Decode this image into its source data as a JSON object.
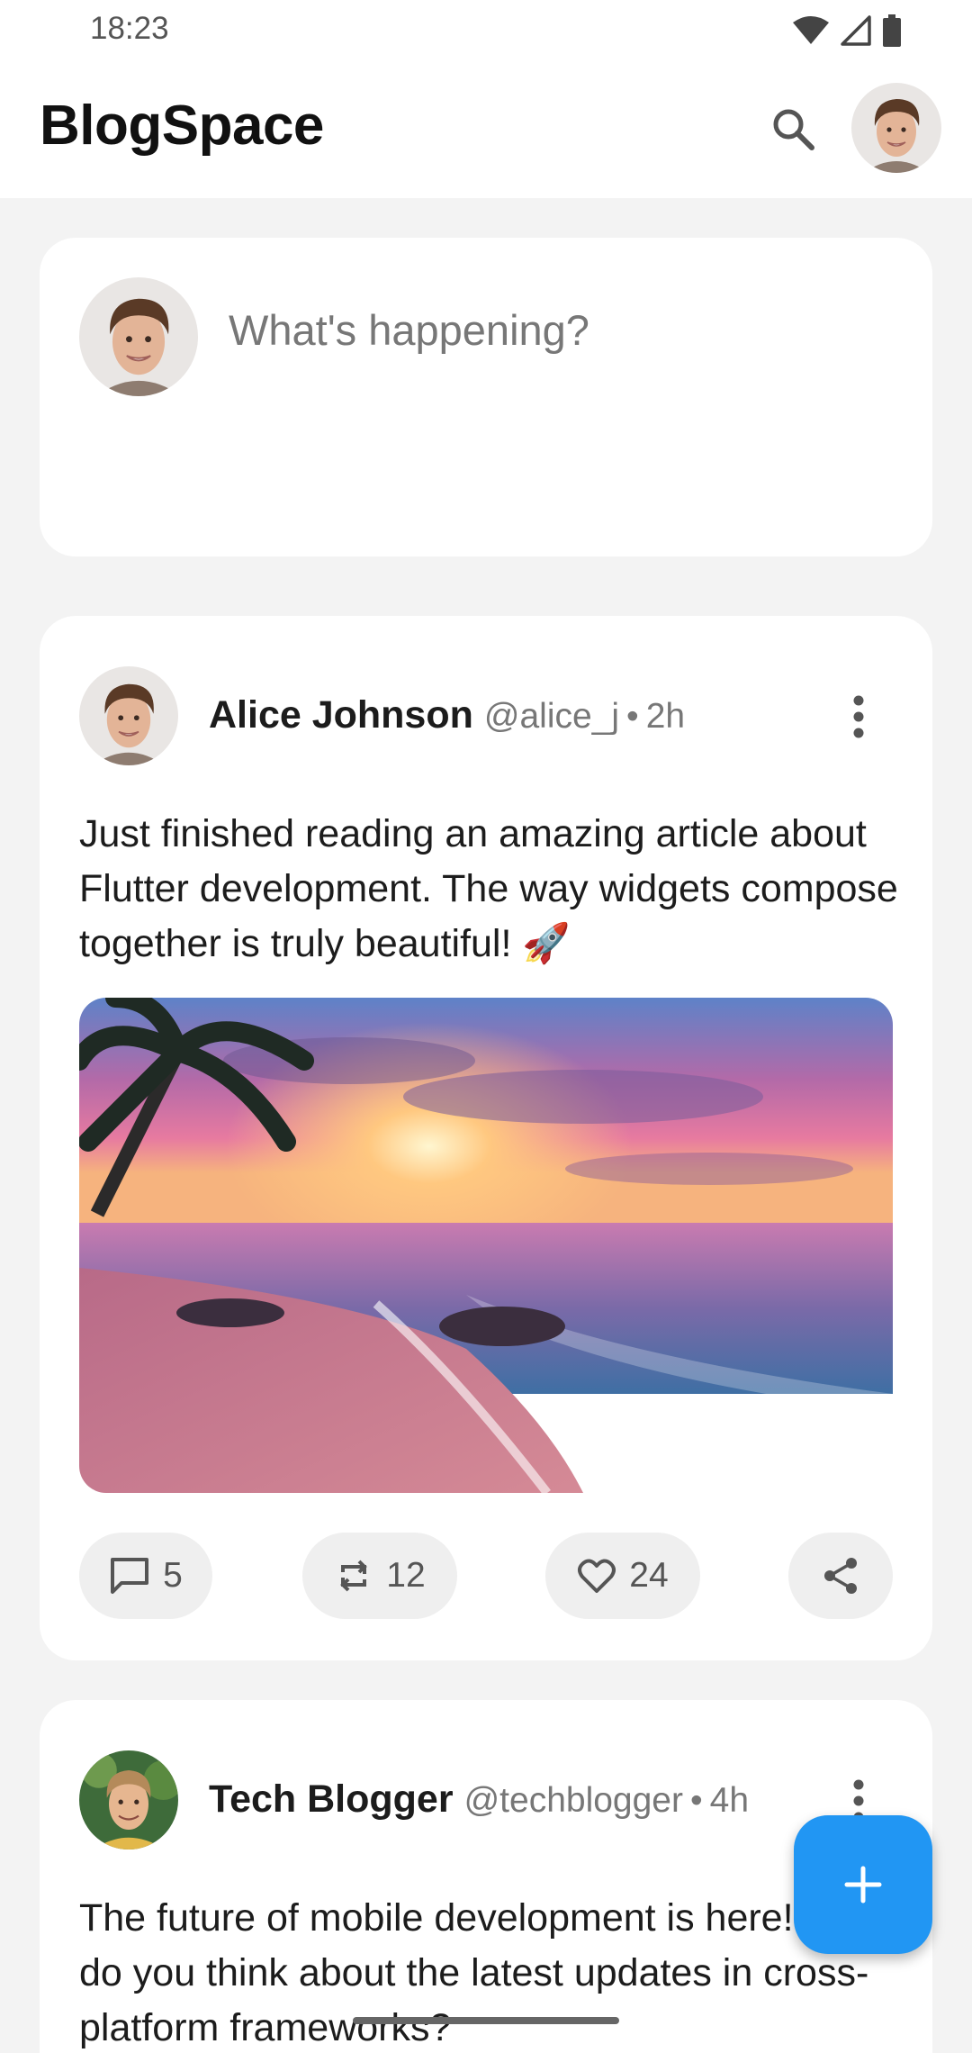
{
  "status_bar": {
    "time": "18:23",
    "icons": [
      "wifi-icon",
      "cell-signal-icon",
      "battery-icon"
    ]
  },
  "app_bar": {
    "title": "BlogSpace",
    "search_icon": "search-icon",
    "avatar": "profile-avatar"
  },
  "composer": {
    "placeholder": "What's happening?"
  },
  "posts": [
    {
      "author": "Alice Johnson",
      "handle": "@alice_j",
      "separator": "•",
      "time": "2h",
      "text": "Just finished reading an amazing article about Flutter development. The way widgets compose together is truly beautiful! 🚀",
      "image": "sunset-beach-image",
      "actions": {
        "comments": "5",
        "reposts": "12",
        "likes": "24"
      }
    },
    {
      "author": "Tech Blogger",
      "handle": "@techblogger",
      "separator": "•",
      "time": "4h",
      "text": "The future of mobile development is here! What do you think about the latest updates in cross-platform frameworks?"
    }
  ],
  "fab": {
    "icon": "plus-icon"
  },
  "colors": {
    "accent": "#2196f3",
    "background": "#f3f3f3",
    "card": "#ffffff"
  }
}
